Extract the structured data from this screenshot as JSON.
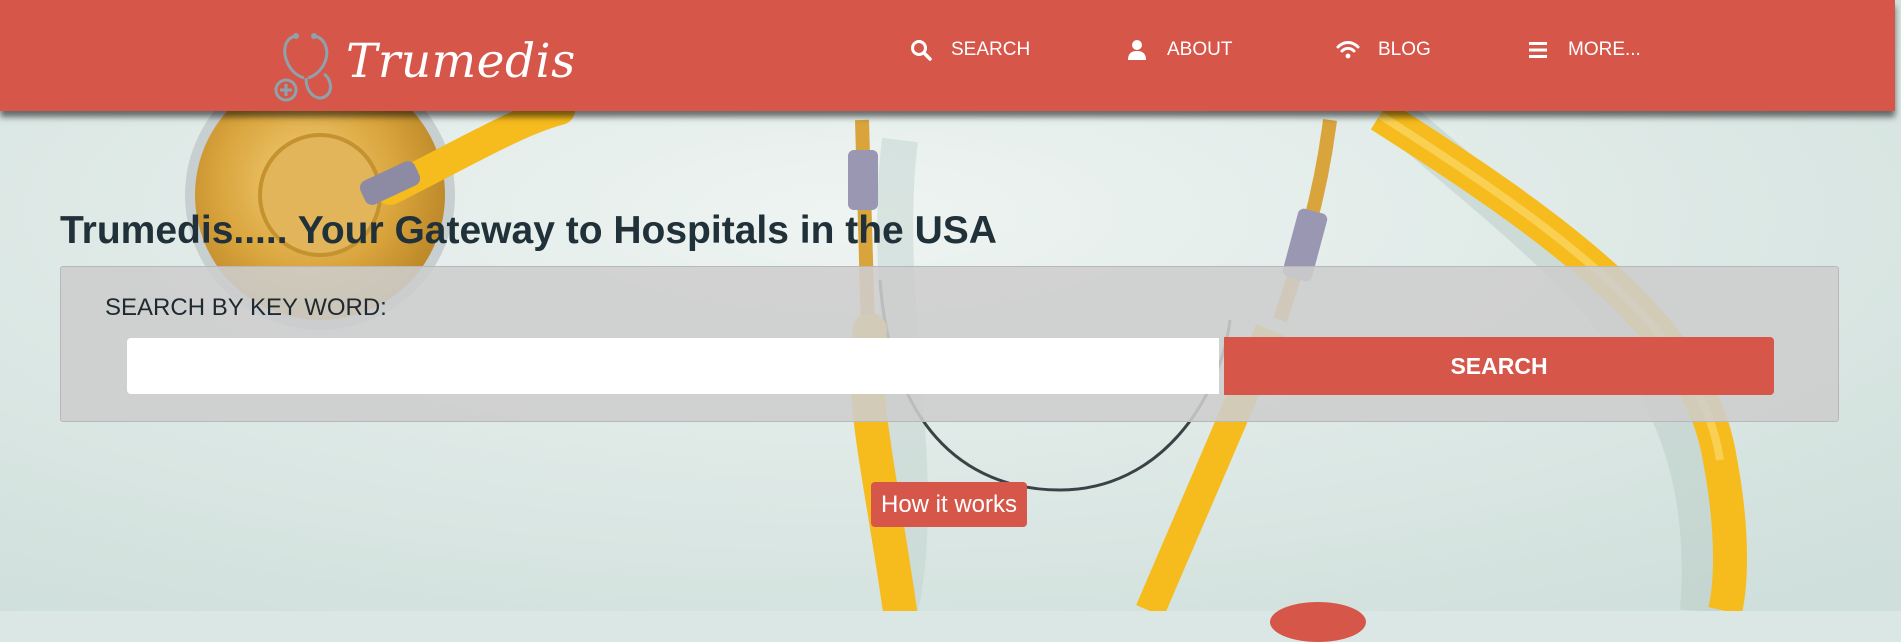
{
  "brand": {
    "name": "Trumedis",
    "logo_icon": "stethoscope-icon"
  },
  "nav": {
    "items": [
      {
        "label": "SEARCH",
        "icon": "search-icon"
      },
      {
        "label": "ABOUT",
        "icon": "user-icon"
      },
      {
        "label": "BLOG",
        "icon": "wifi-icon"
      },
      {
        "label": "MORE...",
        "icon": "menu-icon"
      }
    ]
  },
  "hero": {
    "title": "Trumedis..... Your Gateway to Hospitals in the USA",
    "background_image": "yellow-stethoscope-photo"
  },
  "search": {
    "label": "SEARCH BY KEY WORD:",
    "input_value": "",
    "input_placeholder": "",
    "button_label": "SEARCH"
  },
  "how_it_works": {
    "label": "How it works"
  },
  "colors": {
    "brand_red": "#d6564a",
    "background_mint": "#dbe7e4",
    "tube_yellow": "#f6bb1c",
    "heading_dark": "#21313a"
  }
}
